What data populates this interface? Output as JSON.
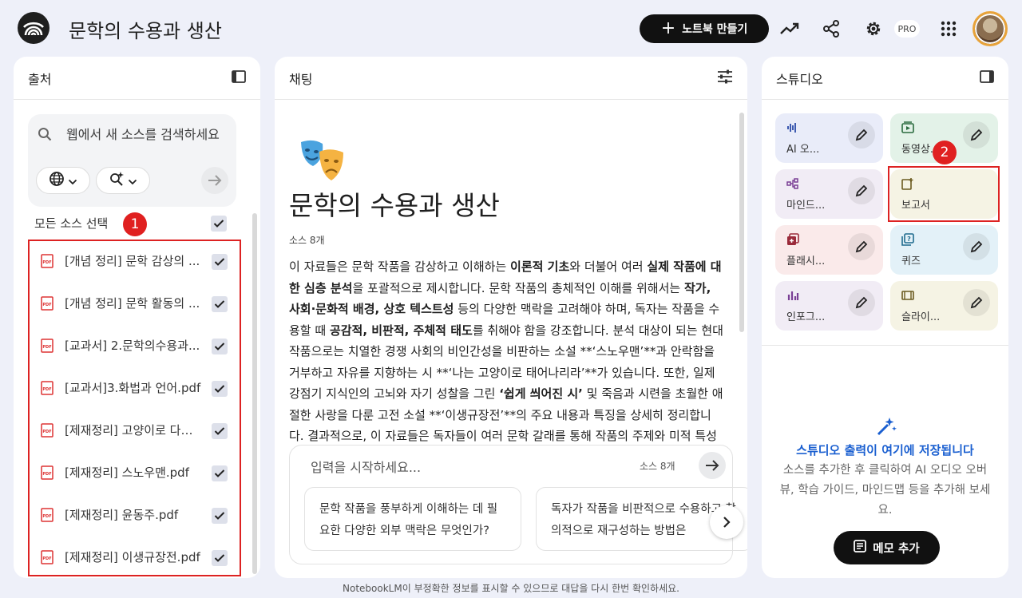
{
  "header": {
    "title": "문학의 수용과 생산",
    "create_notebook": "노트북 만들기",
    "pro": "PRO"
  },
  "sources": {
    "title": "출처",
    "search_placeholder": "웹에서 새 소스를 검색하세요",
    "select_all": "모든 소스 선택",
    "annotation": "1",
    "items": [
      {
        "name": "[개념 정리] 문학 감상의 ..."
      },
      {
        "name": "[개념 정리] 문학 활동의 ..."
      },
      {
        "name": "[교과서] 2.문학의수용과..."
      },
      {
        "name": "[교과서]3.화법과 언어.pdf"
      },
      {
        "name": "[제재정리] 고양이로 다시..."
      },
      {
        "name": "[제재정리] 스노우맨.pdf"
      },
      {
        "name": "[제재정리] 윤동주.pdf"
      },
      {
        "name": "[제재정리] 이생규장전.pdf"
      }
    ]
  },
  "chat": {
    "title": "채팅",
    "notebook_title": "문학의 수용과 생산",
    "source_count": "소스 8개",
    "summary_parts": [
      {
        "t": "이 자료들은 문학 작품을 감상하고 이해하는 ",
        "b": false
      },
      {
        "t": "이론적 기초",
        "b": true
      },
      {
        "t": "와 더불어 여러 ",
        "b": false
      },
      {
        "t": "실제 작품에 대한 심층 분석",
        "b": true
      },
      {
        "t": "을 포괄적으로 제시합니다. 문학 작품의 총체적인 이해를 위해서는 ",
        "b": false
      },
      {
        "t": "작가, 사회·문화적 배경, 상호 텍스트성",
        "b": true
      },
      {
        "t": " 등의 다양한 맥락을 고려해야 하며, 독자는 작품을 수용할 때 ",
        "b": false
      },
      {
        "t": "공감적, 비판적, 주체적 태도",
        "b": true
      },
      {
        "t": "를 취해야 함을 강조합니다. 분석 대상이 되는 현대 작품으로는 치열한 경쟁 사회의 비인간성을 비판하는 소설 **‘스노우맨’**과 안락함을 거부하고 자유를 지향하는 시 **‘나는 고양이로 태어나리라’**가 있습니다. 또한, 일제 강점기 지식인의 고뇌와 자기 성찰을 그린 ",
        "b": false
      },
      {
        "t": "‘쉽게 씌어진 시’",
        "b": true
      },
      {
        "t": " 및 죽음과 시련을 초월한 애절한 사랑을 다룬 고전 소설 **‘이생규장전’**의 주요 내용과 특징을 상세히 정리합니다. 결과적으로, 이 자료들은 독자들이 여러 문학 갈래를 통해 작품의 주제와 미적 특성",
        "b": false
      }
    ],
    "input_placeholder": "입력을 시작하세요...",
    "input_source_count": "소스 8개",
    "suggestions": [
      "문학 작품을 풍부하게 이해하는 데 필요한 다양한 외부 맥락은 무엇인가?",
      "독자가 작품을 비판적으로 수용하고 창의적으로 재구성하는 방법은"
    ]
  },
  "studio": {
    "title": "스튜디오",
    "annotation": "2",
    "tiles": [
      {
        "label": "AI 오...",
        "icon": "audio-icon",
        "bg": "#e9ecf9",
        "fg": "#2a4aa8"
      },
      {
        "label": "동영상...",
        "icon": "video-icon",
        "bg": "#e3f2e8",
        "fg": "#2a6b3e"
      },
      {
        "label": "마인드...",
        "icon": "mindmap-icon",
        "bg": "#f1ecf5",
        "fg": "#7a3f95"
      },
      {
        "label": "보고서",
        "icon": "report-icon",
        "bg": "#f5f3e4",
        "fg": "#6a5a1e"
      },
      {
        "label": "플래시...",
        "icon": "flashcard-icon",
        "bg": "#faeaea",
        "fg": "#9a2a3a"
      },
      {
        "label": "퀴즈",
        "icon": "quiz-icon",
        "bg": "#e3f1f8",
        "fg": "#1e6b8e"
      },
      {
        "label": "인포그...",
        "icon": "infographic-icon",
        "bg": "#f1ecf5",
        "fg": "#7a3f95"
      },
      {
        "label": "슬라이...",
        "icon": "slides-icon",
        "bg": "#f5f3e4",
        "fg": "#6a5a1e"
      }
    ],
    "empty_title": "스튜디오 출력이 여기에 저장됩니다",
    "empty_desc": "소스를 추가한 후 클릭하여 AI 오디오 오버뷰, 학습 가이드, 마인드맵 등을 추가해 보세요.",
    "memo_button": "메모 추가"
  },
  "footer": "NotebookLM이 부정확한 정보를 표시할 수 있으므로 대답을 다시 한번 확인하세요."
}
